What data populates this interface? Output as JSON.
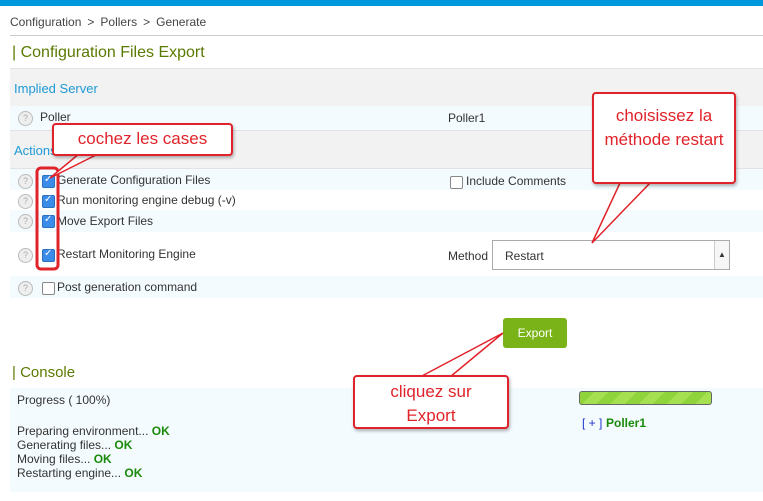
{
  "breadcrumb": [
    "Configuration",
    ">",
    "Pollers",
    ">",
    "Generate"
  ],
  "title": "| Configuration Files Export",
  "implied_server": {
    "header": "Implied Server",
    "label": "Poller",
    "value": "Poller1"
  },
  "actions": {
    "header": "Actions",
    "rows": [
      {
        "label": "Generate Configuration Files",
        "checked": true
      },
      {
        "label": "Run monitoring engine debug (-v)",
        "checked": true
      },
      {
        "label": "Move Export Files",
        "checked": true
      },
      {
        "label": "Restart Monitoring Engine",
        "checked": true
      },
      {
        "label": "Post generation command",
        "checked": false
      }
    ],
    "include_comments": {
      "label": "Include Comments",
      "checked": false
    },
    "method_label": "Method",
    "method_value": "Restart"
  },
  "export_label": "Export",
  "console": {
    "title": "| Console",
    "progress_label": "Progress ( 100%)",
    "progress": 100,
    "log": [
      {
        "text": "Preparing environment...",
        "status": "OK"
      },
      {
        "text": "Generating files...",
        "status": "OK"
      },
      {
        "text": "Moving files...",
        "status": "OK"
      },
      {
        "text": "Restarting engine...",
        "status": "OK"
      }
    ],
    "expand": "[ + ]",
    "poller": "Poller1"
  },
  "callouts": {
    "checkboxes": "cochez les cases",
    "method": "choisissez la méthode restart",
    "export": "cliquez sur Export"
  },
  "colors": {
    "accent": "#0098dc",
    "button": "#7ab317",
    "annotation": "#e0232a",
    "ok": "#1a8a0a"
  }
}
